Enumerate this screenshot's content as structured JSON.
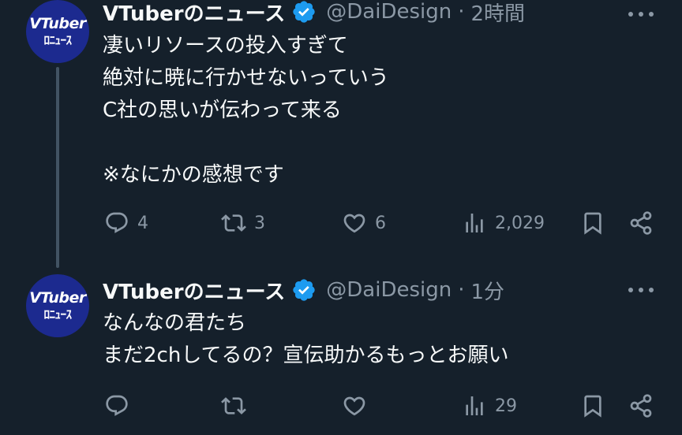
{
  "colors": {
    "background": "#15202b",
    "text_primary": "#f7f9f9",
    "text_secondary": "#8b98a5",
    "verified_blue": "#1d9bf0",
    "avatar_bg": "#1c2a8f",
    "thread_line": "#425363"
  },
  "tweets": [
    {
      "avatar": {
        "line1": "VTuber",
        "line2": "ﾛﾆｭｰｽ"
      },
      "name": "VTuberのニュース",
      "verified_icon": "verified-badge-icon",
      "handle": "@DaiDesign",
      "dot": "·",
      "time": "2時間",
      "lines": [
        "凄いリソースの投入すぎて",
        "絶対に暁に行かせないっていう",
        "C社の思いが伝わって来る",
        "",
        "※なにかの感想です"
      ],
      "actions": {
        "replies": "4",
        "retweets": "3",
        "likes": "6",
        "views": "2,029"
      }
    },
    {
      "avatar": {
        "line1": "VTuber",
        "line2": "ﾛﾆｭｰｽ"
      },
      "name": "VTuberのニュース",
      "verified_icon": "verified-badge-icon",
      "handle": "@DaiDesign",
      "dot": "·",
      "time": "1分",
      "lines": [
        "なんなの君たち",
        "まだ2chしてるの？宣伝助かるもっとお願い"
      ],
      "actions": {
        "replies": "",
        "retweets": "",
        "likes": "",
        "views": "29"
      }
    }
  ]
}
